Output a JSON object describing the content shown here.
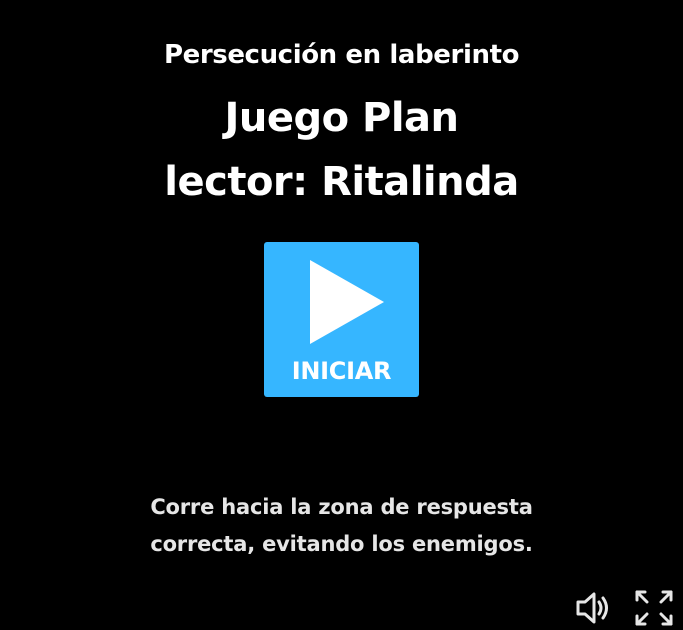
{
  "activity": {
    "subtitle": "Persecución en laberinto",
    "title_line1": "Juego Plan",
    "title_line2": "lector: Ritalinda"
  },
  "start_button": {
    "label": "INICIAR",
    "icon": "play-icon",
    "color": "#36b6ff"
  },
  "instructions": {
    "line1": "Corre hacia la zona de respuesta",
    "line2": "correcta, evitando los enemigos."
  },
  "controls": {
    "sound_icon": "speaker-icon",
    "fullscreen_icon": "fullscreen-icon"
  },
  "colors": {
    "background": "#000000",
    "text": "#ffffff",
    "accent": "#36b6ff"
  }
}
